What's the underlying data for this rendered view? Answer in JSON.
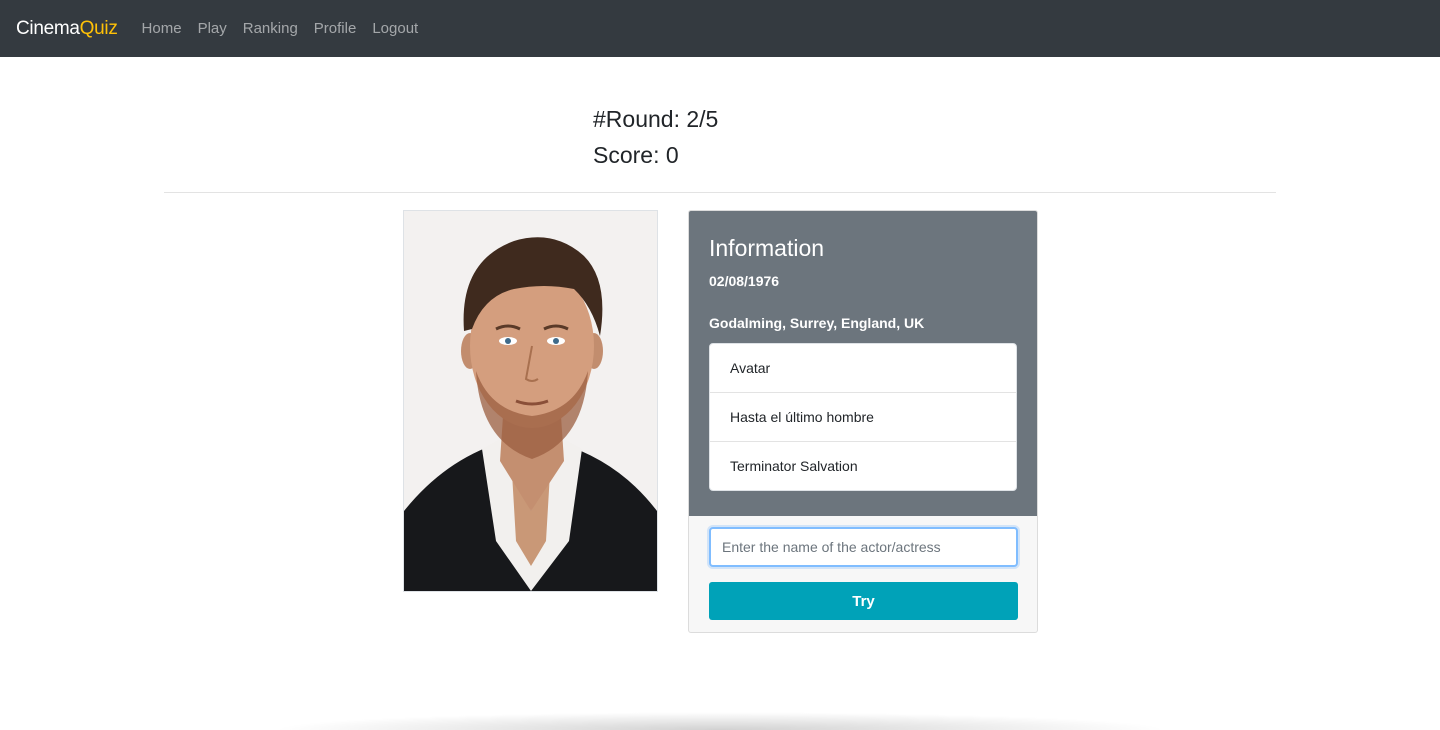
{
  "navbar": {
    "brand_part1": "Cinema",
    "brand_part2": "Quiz",
    "links": [
      "Home",
      "Play",
      "Ranking",
      "Profile",
      "Logout"
    ]
  },
  "game": {
    "round_text": "#Round: 2/5",
    "score_text": "Score: 0"
  },
  "info_card": {
    "title": "Information",
    "birth_date": "02/08/1976",
    "birth_place": "Godalming, Surrey, England, UK",
    "movies": [
      "Avatar",
      "Hasta el último hombre",
      "Terminator Salvation"
    ]
  },
  "guess": {
    "placeholder": "Enter the name of the actor/actress",
    "button_label": "Try"
  },
  "colors": {
    "navbar_bg": "#343a40",
    "brand_accent": "#ffc107",
    "card_header_bg": "#6c757d",
    "button_bg": "#00a2b8"
  }
}
